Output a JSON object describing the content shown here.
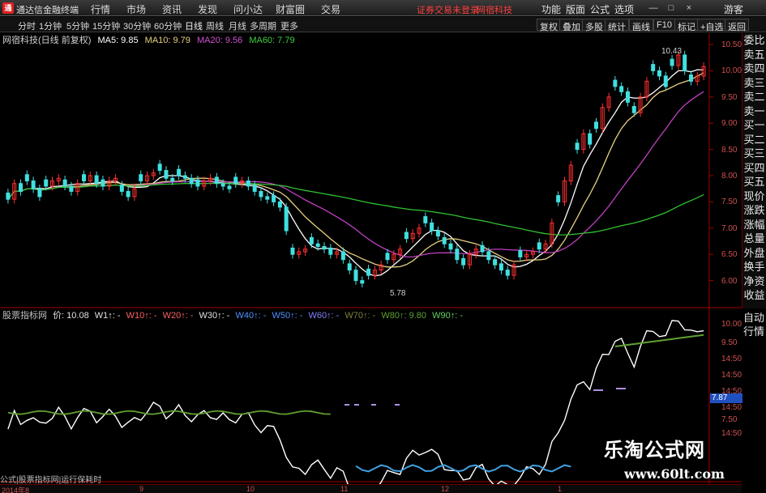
{
  "window": {
    "app_title": "通达信金融终端",
    "logo_char": "通",
    "minimize": "—",
    "maximize": "□",
    "close": "×"
  },
  "menu": [
    "行情",
    "市场",
    "资讯",
    "发现",
    "问小达",
    "财富圈",
    "交易"
  ],
  "login_warning": "证券交易未登录",
  "login_stock": "网宿科技",
  "right_menu": [
    "功能",
    "版面",
    "公式",
    "选项"
  ],
  "user": "游客",
  "toolbar": {
    "periods": [
      "分时",
      "1分钟",
      "5分钟",
      "15分钟",
      "30分钟",
      "60分钟",
      "日线",
      "周线",
      "月线",
      "多周期",
      "更多"
    ],
    "right": [
      "复权",
      "叠加",
      "多股",
      "统计",
      "画线",
      "F10",
      "标记",
      "+自选",
      "返回"
    ]
  },
  "main_header": {
    "stock": "网宿科技(日线 前复权)",
    "ma5": "MA5: 9.85",
    "ma10": "MA10: 9.79",
    "ma20": "MA20: 9.56",
    "ma60": "MA60: 7.79"
  },
  "price_axis": [
    "10.50",
    "10.00",
    "9.50",
    "9.00",
    "8.50",
    "8.00",
    "7.50",
    "7.00",
    "6.50",
    "6.00"
  ],
  "annotations": {
    "high": "10.43",
    "low": "5.78"
  },
  "sidebar": [
    "委比",
    "卖五",
    "卖四",
    "卖三",
    "卖二",
    "卖一",
    "买一",
    "买二",
    "买三",
    "买四",
    "买五",
    "现价",
    "涨跌",
    "涨幅",
    "总量",
    "外盘",
    "换手",
    "净资",
    "收益"
  ],
  "sidebar_top": "委比",
  "sidebar2": [
    "自动",
    "行情"
  ],
  "sub_header": {
    "name": "股票指标网",
    "price": "价: 10.08",
    "labels": [
      "W1↑: -",
      "W10↑: -",
      "W20↑: -",
      "W30↑: -",
      "W40↑: -",
      "W50↑: -",
      "W60↑: -",
      "W70↑: -",
      "W80↑: 9.80",
      "W90↑: -"
    ]
  },
  "sub_axis": [
    "10.00",
    "9.50",
    "14:50",
    "14:50",
    "14:50",
    "14:50",
    "7.50",
    "14:50"
  ],
  "sub_current": "7.87",
  "dates": [
    "2014年8",
    "9",
    "10",
    "11",
    "12",
    "1"
  ],
  "status_text": "公式|股票指标网|运行保耗时",
  "watermark": {
    "title": "乐淘公式网",
    "url": "www.60lt.com"
  },
  "colors": {
    "up": "#ff3030",
    "down": "#40e0e0",
    "ma5": "#ffffff",
    "ma10": "#e8d080",
    "ma20": "#c040c0",
    "ma60": "#30c030",
    "axis_red": "#a00000",
    "w80": "#60a030",
    "w_white": "#ffffff",
    "w_blue": "#40a0e0",
    "w_purple": "#b090e0"
  }
}
